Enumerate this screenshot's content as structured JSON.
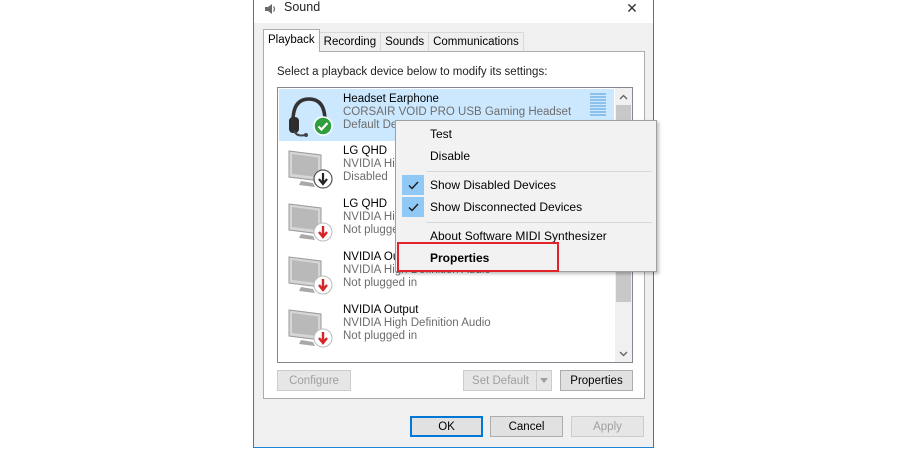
{
  "window": {
    "title": "Sound",
    "close_glyph": "✕"
  },
  "tabs": [
    {
      "label": "Playback",
      "active": true
    },
    {
      "label": "Recording",
      "active": false
    },
    {
      "label": "Sounds",
      "active": false
    },
    {
      "label": "Communications",
      "active": false
    }
  ],
  "instruction": "Select a playback device below to modify its settings:",
  "devices": [
    {
      "name": "Headset Earphone",
      "description": "CORSAIR VOID PRO USB Gaming Headset",
      "status": "Default De",
      "icon": "headset-icon",
      "badge": "default-check-icon",
      "selected": true
    },
    {
      "name": "LG QHD",
      "description": "NVIDIA High",
      "status": "Disabled",
      "icon": "monitor-speaker-icon",
      "badge": "disabled-arrow-icon",
      "selected": false
    },
    {
      "name": "LG QHD",
      "description": "NVIDIA High",
      "status": "Not plugged",
      "icon": "monitor-speaker-icon",
      "badge": "unplugged-arrow-icon",
      "selected": false
    },
    {
      "name": "NVIDIA Ou",
      "description": "NVIDIA High Definition Audio",
      "status": "Not plugged in",
      "icon": "monitor-speaker-icon",
      "badge": "unplugged-arrow-icon",
      "selected": false
    },
    {
      "name": "NVIDIA Output",
      "description": "NVIDIA High Definition Audio",
      "status": "Not plugged in",
      "icon": "monitor-speaker-icon",
      "badge": "unplugged-arrow-icon",
      "selected": false
    }
  ],
  "buttons": {
    "configure": "Configure",
    "set_default": "Set Default",
    "properties": "Properties",
    "ok": "OK",
    "cancel": "Cancel",
    "apply": "Apply"
  },
  "context_menu": {
    "items": [
      {
        "label": "Test",
        "checked": false,
        "bold": false
      },
      {
        "label": "Disable",
        "checked": false,
        "bold": false
      },
      {
        "label": "Show Disabled Devices",
        "checked": true,
        "bold": false
      },
      {
        "label": "Show Disconnected Devices",
        "checked": true,
        "bold": false
      },
      {
        "label": "About Software MIDI Synthesizer",
        "checked": false,
        "bold": false
      },
      {
        "label": "Properties",
        "checked": false,
        "bold": true
      }
    ]
  },
  "colors": {
    "accent": "#0078d7",
    "selection": "#cce8ff",
    "highlight_box": "#e3232a",
    "default_badge": "#2e9e3e",
    "unplugged_badge": "#d62424"
  }
}
